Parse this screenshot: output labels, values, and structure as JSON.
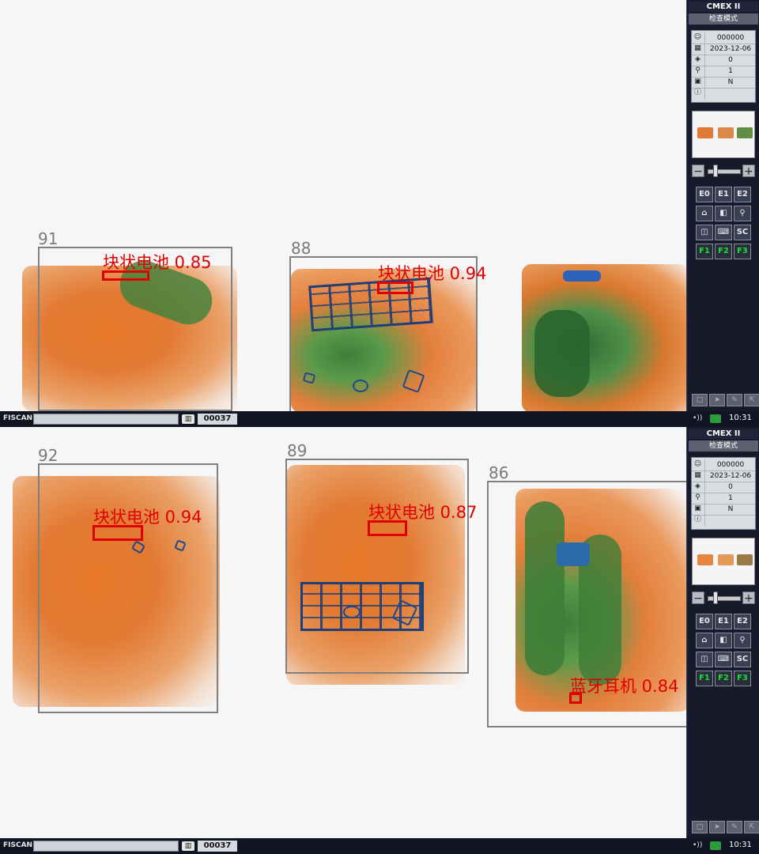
{
  "app": {
    "system_name": "CMEX II",
    "mode_label": "检查模式",
    "brand": "FISCAN",
    "bag_count": "00037",
    "time": "10:31"
  },
  "info_panel": {
    "operator_id": "000000",
    "date": "2023-12-06",
    "bag_number": "0",
    "zoom_level": "1",
    "status": "N",
    "info": ""
  },
  "buttons": {
    "e0": "E0",
    "e1": "E1",
    "e2": "E2",
    "sc": "SC",
    "f1": "F1",
    "f2": "F2",
    "f3": "F3"
  },
  "icons": {
    "user": "user-icon",
    "calendar": "calendar-icon",
    "counter": "counter-icon",
    "zoom": "magnifier-icon",
    "status": "status-icon",
    "info": "info-icon"
  },
  "colors": {
    "detection": "#e00000",
    "frame": "#808080",
    "sidebar_bg": "#171a2a",
    "fkey_text": "#19e034"
  },
  "top_view": {
    "frames": [
      {
        "label": "91",
        "detection": "块状电池 0.85"
      },
      {
        "label": "88",
        "detection": "块状电池 0.94"
      }
    ]
  },
  "bottom_view": {
    "frames": [
      {
        "label": "92",
        "detection": "块状电池 0.94"
      },
      {
        "label": "89",
        "detection": "块状电池 0.87"
      },
      {
        "label": "86",
        "detection": "蓝牙耳机 0.84"
      }
    ]
  }
}
